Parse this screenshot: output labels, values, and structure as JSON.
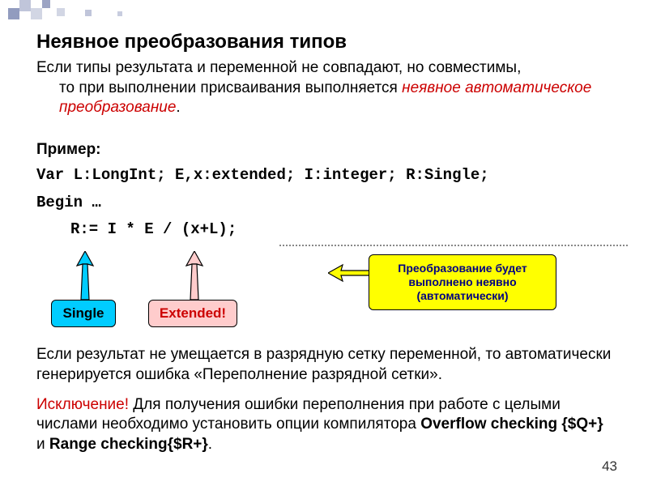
{
  "title": "Неявное преобразования типов",
  "intro": {
    "line1": "Если типы результата и переменной не совпадают, но совместимы,",
    "line2_pre": "то при выполнении присваивания выполняется ",
    "line2_em": "неявное автоматическое преобразование",
    "line2_post": "."
  },
  "example_label": "Пример:",
  "code": {
    "decl": "Var L:LongInt; E,x:extended; I:integer; R:Single;",
    "begin": "Begin …",
    "assign": "R:= I * E / (x+L);"
  },
  "callouts": {
    "single": "Single",
    "extended": "Extended!",
    "yellow": "Преобразование будет выполнено неявно (автоматически)"
  },
  "overflow_para": "Если результат не умещается в разрядную сетку переменной, то автоматически генерируется ошибка «Переполнение разрядной сетки».",
  "exception": {
    "label": "Исключение!",
    "text1": " Для получения ошибки переполнения при работе с целыми числами необходимо установить опции компилятора ",
    "opt1": "Overflow checking {$Q+}",
    "and": " и ",
    "opt2": "Range checking{$R+}",
    "dot": "."
  },
  "page": "43"
}
